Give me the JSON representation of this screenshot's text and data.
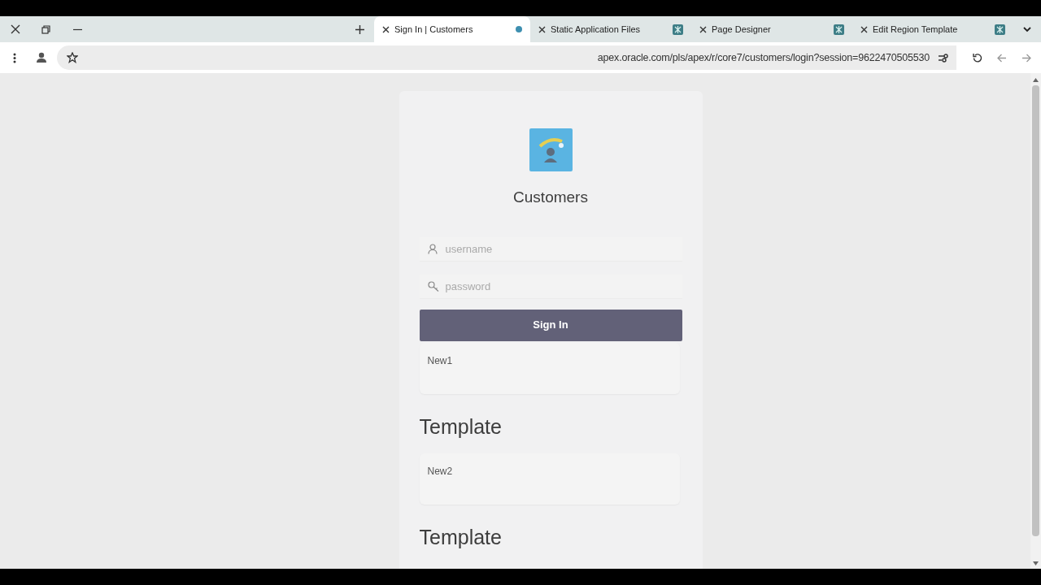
{
  "tabs": [
    {
      "label": "Sign In | Customers",
      "selected": true
    },
    {
      "label": "Static Application Files",
      "selected": false
    },
    {
      "label": "Page Designer",
      "selected": false
    },
    {
      "label": "Edit Region Template",
      "selected": false
    }
  ],
  "address_bar": {
    "url": "apex.oracle.com/pls/apex/r/core7/customers/login?session=9622470505530"
  },
  "login": {
    "app_title": "Customers",
    "username": {
      "placeholder": "username"
    },
    "password": {
      "placeholder": "password"
    },
    "button": "Sign In"
  },
  "blocks": [
    {
      "kind": "region",
      "text": "New1"
    },
    {
      "kind": "heading",
      "text": "Template"
    },
    {
      "kind": "region",
      "text": "New2"
    },
    {
      "kind": "heading",
      "text": "Template"
    }
  ]
}
